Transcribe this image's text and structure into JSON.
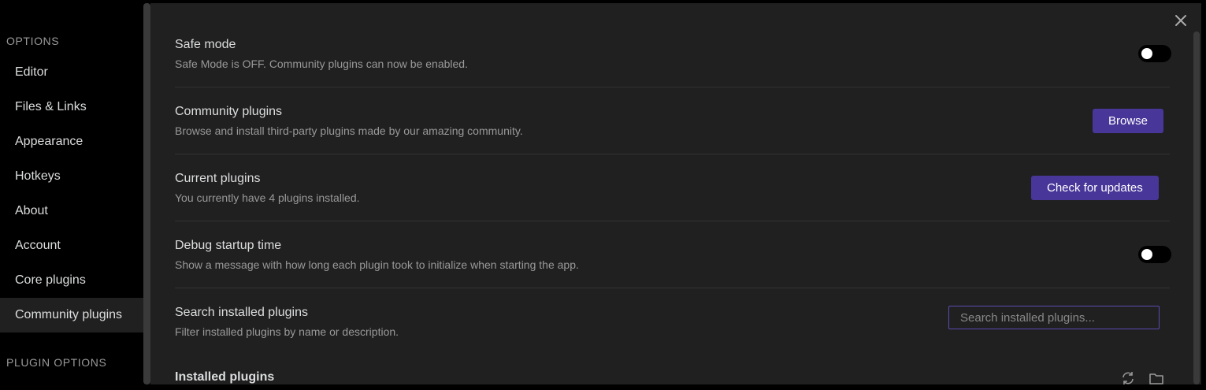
{
  "sidebar": {
    "options_heading": "OPTIONS",
    "items": [
      {
        "label": "Editor"
      },
      {
        "label": "Files & Links"
      },
      {
        "label": "Appearance"
      },
      {
        "label": "Hotkeys"
      },
      {
        "label": "About"
      },
      {
        "label": "Account"
      },
      {
        "label": "Core plugins"
      },
      {
        "label": "Community plugins"
      }
    ],
    "plugin_options_heading": "PLUGIN OPTIONS"
  },
  "settings": {
    "safe_mode": {
      "name": "Safe mode",
      "desc": "Safe Mode is OFF. Community plugins can now be enabled.",
      "enabled": false
    },
    "community": {
      "name": "Community plugins",
      "desc": "Browse and install third-party plugins made by our amazing community.",
      "button": "Browse"
    },
    "current": {
      "name": "Current plugins",
      "desc": "You currently have 4 plugins installed.",
      "button": "Check for updates"
    },
    "debug": {
      "name": "Debug startup time",
      "desc": "Show a message with how long each plugin took to initialize when starting the app.",
      "enabled": false
    },
    "search": {
      "name": "Search installed plugins",
      "desc": "Filter installed plugins by name or description.",
      "placeholder": "Search installed plugins...",
      "value": ""
    },
    "installed": {
      "title": "Installed plugins"
    }
  },
  "colors": {
    "accent": "#483699",
    "background": "#202020",
    "sidebar": "#000000"
  },
  "icons": {
    "close": "close-icon",
    "reload": "reload-icon",
    "folder": "folder-icon"
  }
}
